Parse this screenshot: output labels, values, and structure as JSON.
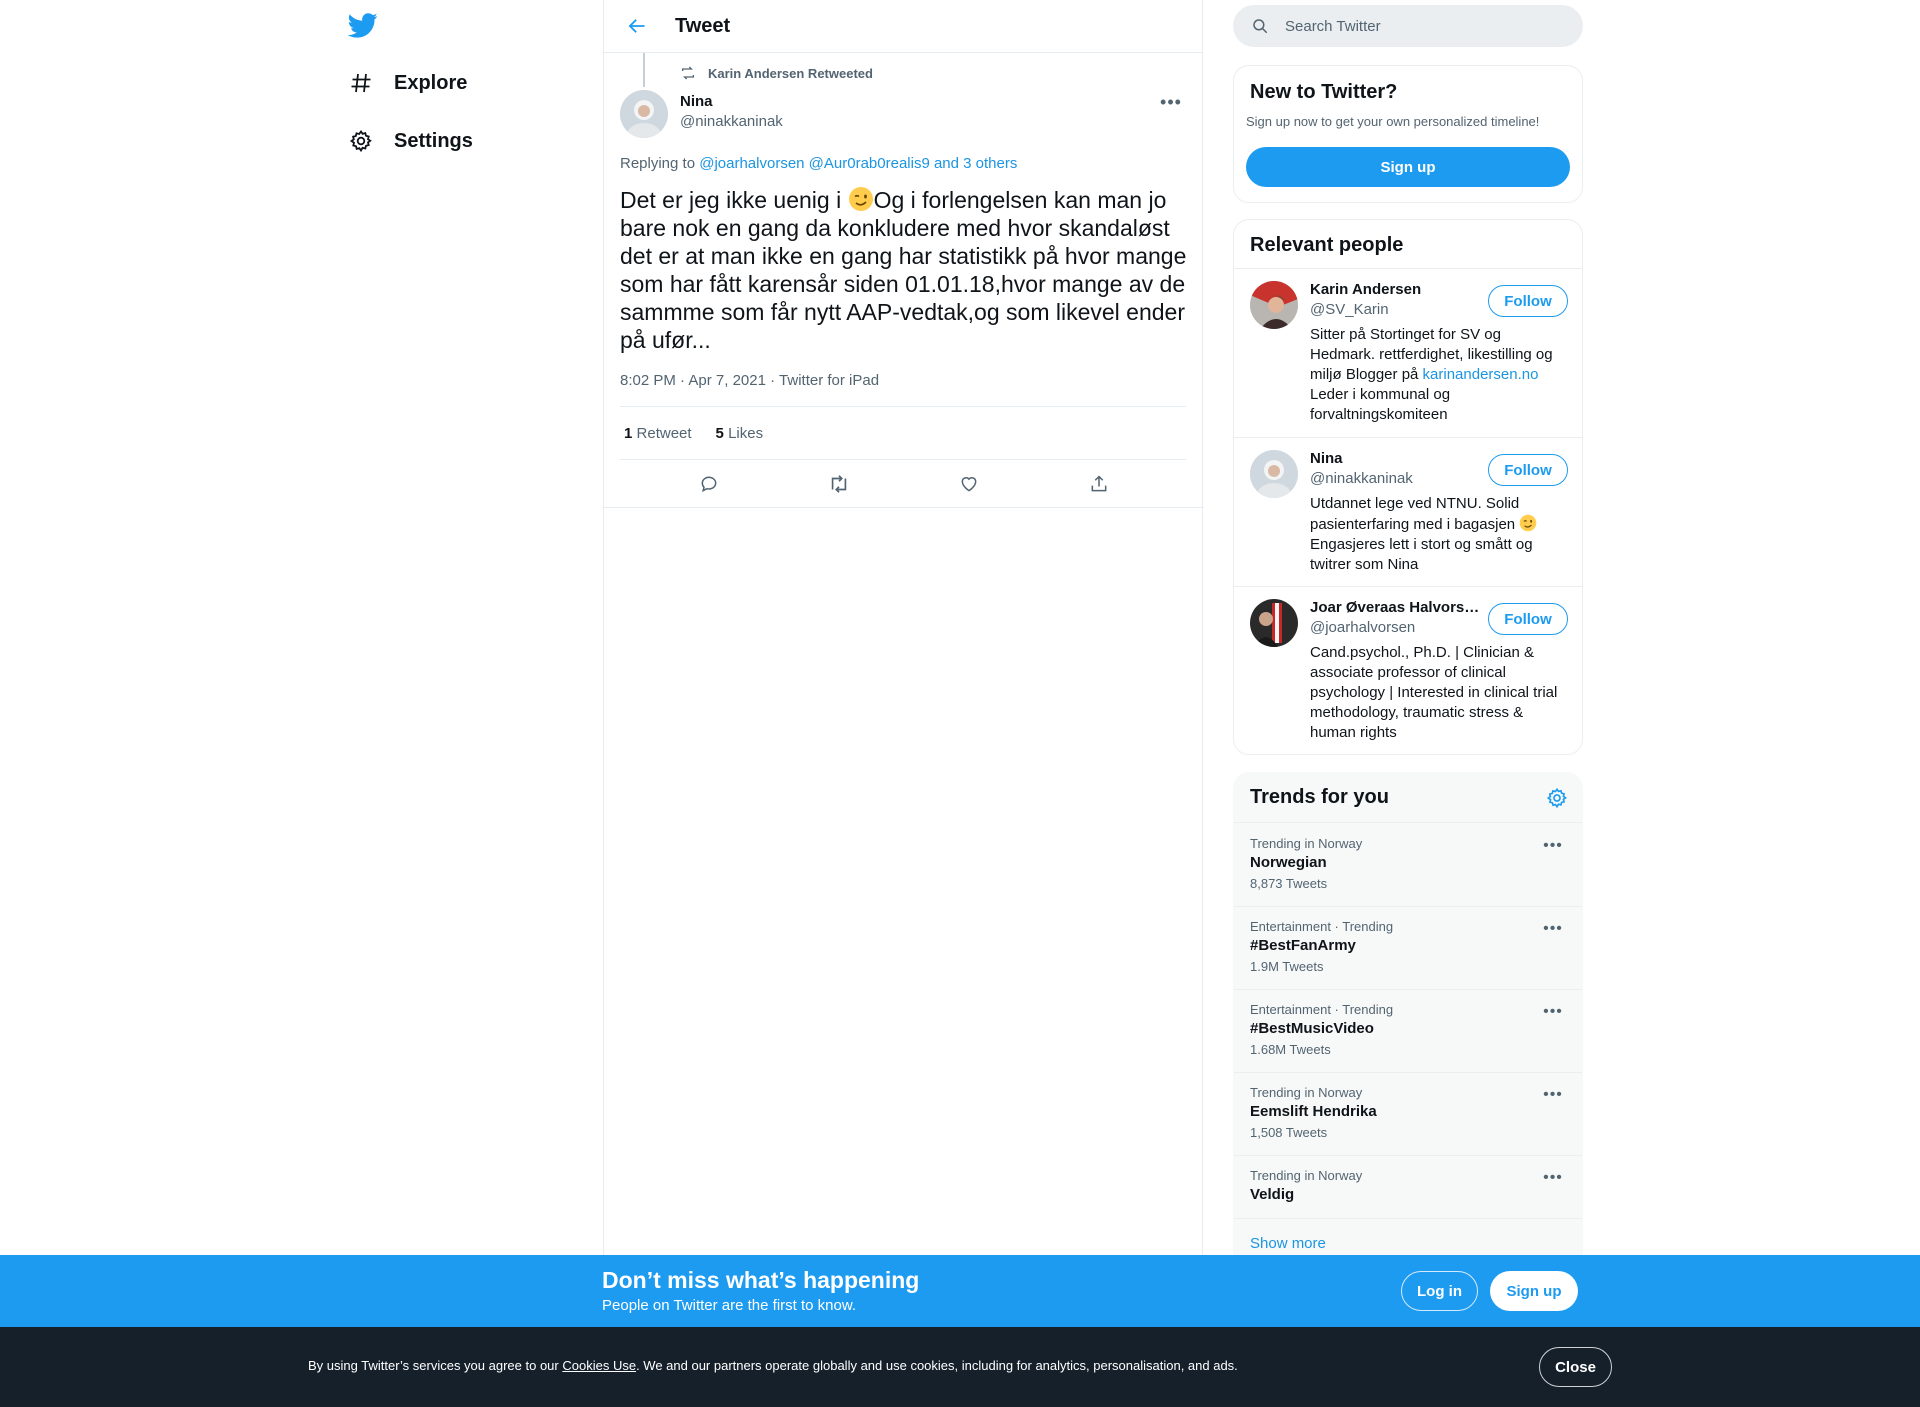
{
  "nav": {
    "logo_icon": "twitter-bird-icon",
    "items": [
      {
        "label": "Explore",
        "icon": "hashtag-icon"
      },
      {
        "label": "Settings",
        "icon": "gear-icon"
      }
    ]
  },
  "header": {
    "title": "Tweet",
    "back_icon": "arrow-left-icon"
  },
  "tweet": {
    "retweet_context": "Karin Andersen Retweeted",
    "author_name": "Nina",
    "author_handle": "@ninakkaninak",
    "replying_prefix": "Replying to ",
    "replying_to_1": "@joarhalvorsen",
    "replying_to_2": "@Aur0rab0realis9",
    "replying_others": "and 3 others",
    "text_part1": "Det er jeg ikke uenig i ",
    "text_part2": "Og i forlengelsen kan man jo bare nok en gang da konkludere med hvor skandaløst det er at man ikke en gang har statistikk på hvor mange som har fått karensår siden 01.01.18,hvor mange av de sammme som får nytt AAP-vedtak,og som likevel ender på ufør...",
    "time": "8:02 PM",
    "separator": "·",
    "date": "Apr 7, 2021",
    "source": "Twitter for iPad",
    "retweet_count": "1",
    "retweet_label": "Retweet",
    "like_count": "5",
    "like_label": "Likes"
  },
  "search": {
    "placeholder": "Search Twitter"
  },
  "new_to_twitter": {
    "title": "New to Twitter?",
    "subtitle": "Sign up now to get your own personalized timeline!",
    "signup_label": "Sign up"
  },
  "relevant_people": {
    "title": "Relevant people",
    "follow_label": "Follow",
    "people": [
      {
        "name": "Karin Andersen",
        "handle": "@SV_Karin",
        "bio_part1": "Sitter på Stortinget for SV og Hedmark. rettferdighet, likestilling og miljø Blogger på ",
        "bio_link": "karinandersen.no",
        "bio_part2": " Leder i kommunal og forvaltningskomiteen"
      },
      {
        "name": "Nina",
        "handle": "@ninakkaninak",
        "bio_part1": "Utdannet lege ved NTNU. Solid pasienterfaring med i bagasjen ",
        "bio_part2": " Engasjeres lett i stort og smått og twitrer som Nina"
      },
      {
        "name": "Joar Øveraas Halvorsen",
        "handle": "@joarhalvorsen",
        "bio_part1": "Cand.psychol., Ph.D. | Clinician & associate professor of clinical psychology | Interested in clinical trial methodology, traumatic stress & human rights"
      }
    ]
  },
  "trends": {
    "title": "Trends for you",
    "items": [
      {
        "meta": "Trending in Norway",
        "name": "Norwegian",
        "count": "8,873 Tweets"
      },
      {
        "meta": "Entertainment · Trending",
        "name": "#BestFanArmy",
        "count": "1.9M Tweets"
      },
      {
        "meta": "Entertainment · Trending",
        "name": "#BestMusicVideo",
        "count": "1.68M Tweets"
      },
      {
        "meta": "Trending in Norway",
        "name": "Eemslift Hendrika",
        "count": "1,508 Tweets"
      },
      {
        "meta": "Trending in Norway",
        "name": "Veldig",
        "count": ""
      }
    ],
    "show_more": "Show more"
  },
  "banner": {
    "title": "Don’t miss what’s happening",
    "subtitle": "People on Twitter are the first to know.",
    "login_label": "Log in",
    "signup_label": "Sign up"
  },
  "cookie": {
    "text_before": "By using Twitter’s services you agree to our ",
    "link": "Cookies Use",
    "text_after": ". We and our partners operate globally and use cookies, including for analytics, personalisation, and ads.",
    "close_label": "Close"
  },
  "colors": {
    "accent": "#1d9bf0",
    "link": "#1b95e0",
    "text": "#0f1419",
    "muted": "#536471",
    "cookie_bg": "#15202b"
  }
}
